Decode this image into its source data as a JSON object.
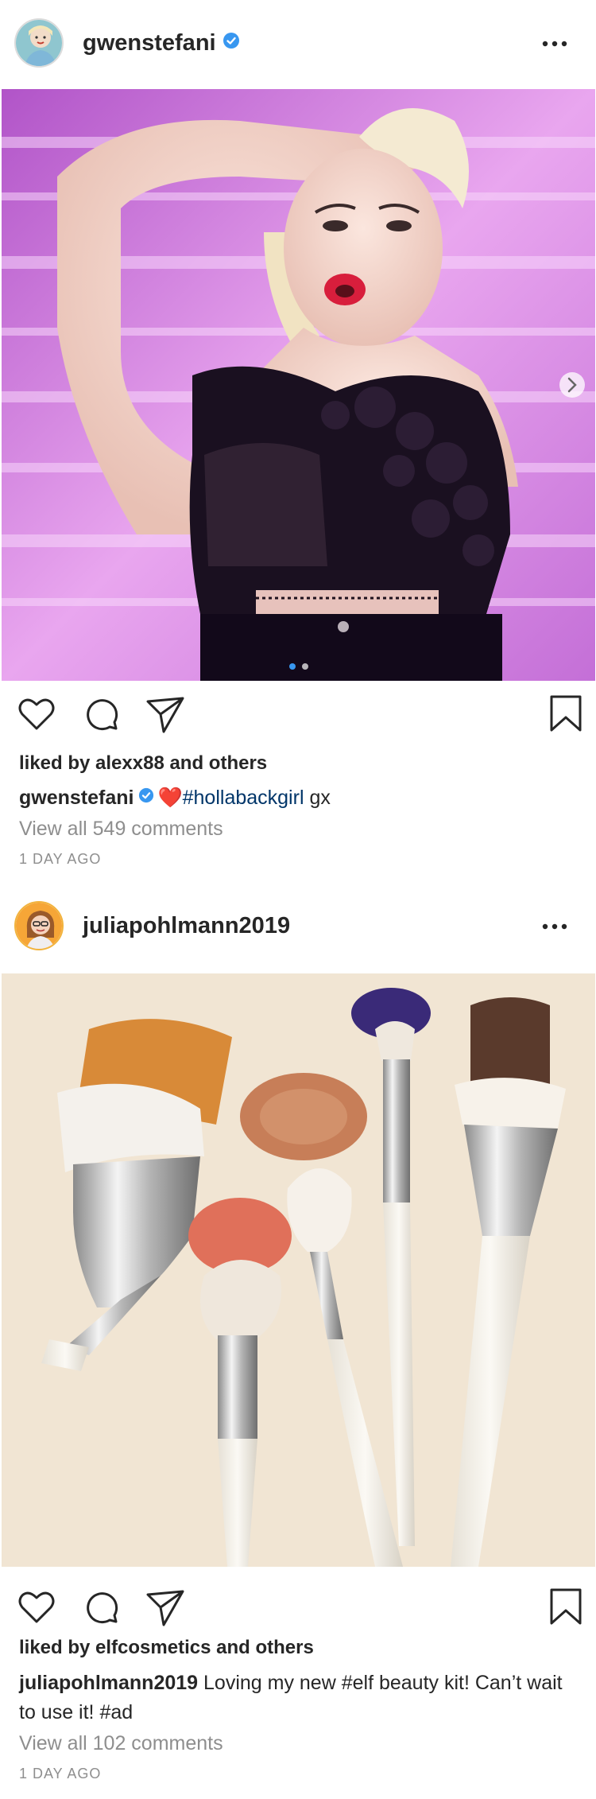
{
  "posts": [
    {
      "username": "gwenstefani",
      "verified": true,
      "likes_text": "liked by alexx88 and others",
      "caption_user": "gwenstefani",
      "caption_emoji": "❤️",
      "caption_tag": "#hollabackgirl",
      "caption_rest": " gx",
      "comments_text": "View all 549 comments",
      "time_text": "1 DAY AGO",
      "carousel_dots": 2,
      "carousel_active": 1
    },
    {
      "username": "juliapohlmann2019",
      "verified": false,
      "likes_text": "liked by elfcosmetics and others",
      "caption_user": "juliapohlmann2019",
      "caption_text": " Loving my new #elf beauty kit!  Can’t wait to use it! #ad",
      "comments_text": "View all 102 comments",
      "time_text": "1 DAY AGO"
    }
  ],
  "icons": {
    "more": "more-options-icon",
    "like": "heart-icon",
    "comment": "comment-icon",
    "share": "send-icon",
    "save": "bookmark-icon",
    "verified": "verified-badge-icon",
    "next": "chevron-right-icon"
  },
  "colors": {
    "text": "#262626",
    "secondary": "#8e8e8e",
    "hashtag": "#003569",
    "verified": "#3897f0",
    "heart": "#ed1c24"
  }
}
